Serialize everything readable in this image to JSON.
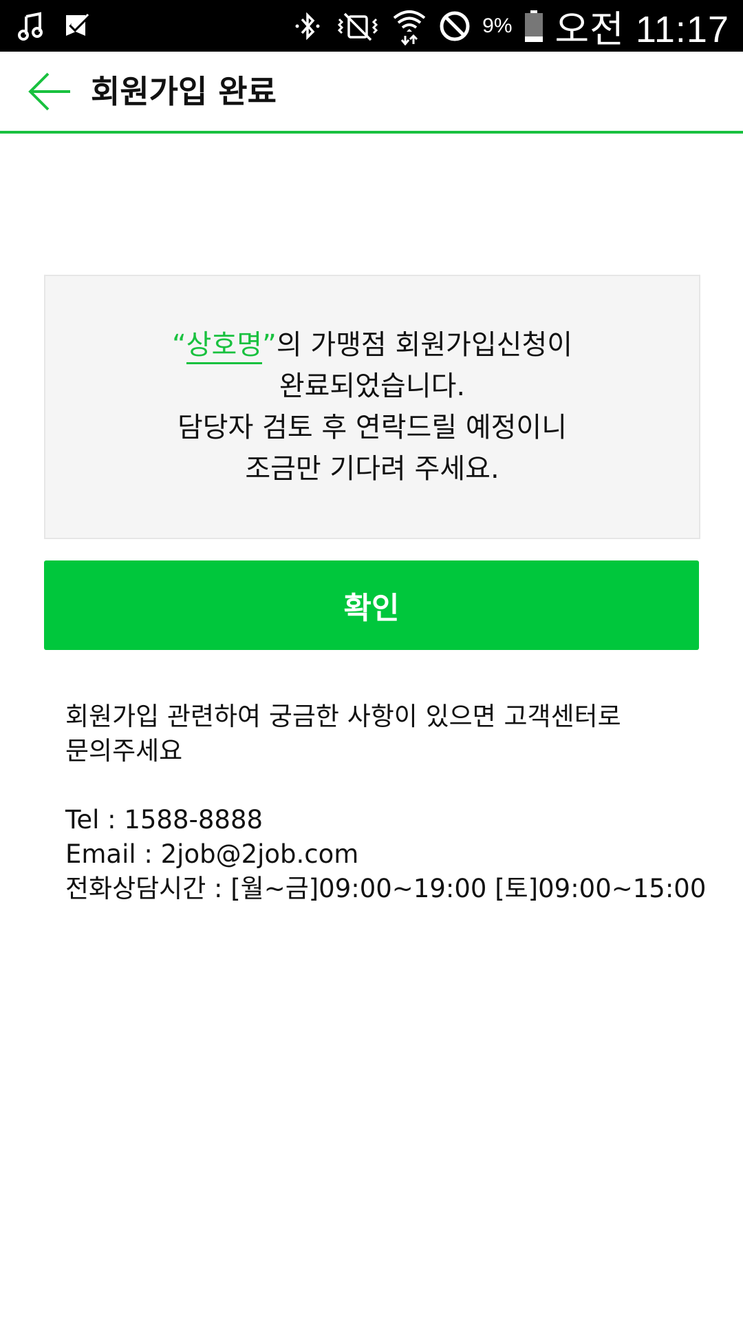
{
  "status_bar": {
    "battery_percent": "9%",
    "time": "오전 11:17",
    "left_icons": [
      "music-icon",
      "check-notification-icon"
    ],
    "right_icons": [
      "bluetooth-icon",
      "vibrate-mute-icon",
      "wifi-icon",
      "do-not-disturb-icon",
      "battery-icon"
    ]
  },
  "header": {
    "title": "회원가입 완료",
    "back_icon": "back-arrow-icon",
    "accent_color": "#19c13f"
  },
  "message": {
    "open_quote": "“",
    "business_name": "상호명",
    "close_quote": "”",
    "line1_rest": "의 가맹점 회원가입신청이",
    "line2": "완료되었습니다.",
    "line3": "담당자 검토 후 연락드릴 예정이니",
    "line4": "조금만 기다려 주세요."
  },
  "confirm_button": {
    "label": "확인",
    "color": "#00c73c"
  },
  "contact": {
    "inquiry_line1": "회원가입 관련하여 궁금한 사항이 있으면 고객센터로",
    "inquiry_line2": "문의주세요",
    "tel": "Tel : 1588-8888",
    "email": "Email : 2job@2job.com",
    "hours": "전화상담시간 : [월~금]09:00~19:00 [토]09:00~15:00"
  }
}
